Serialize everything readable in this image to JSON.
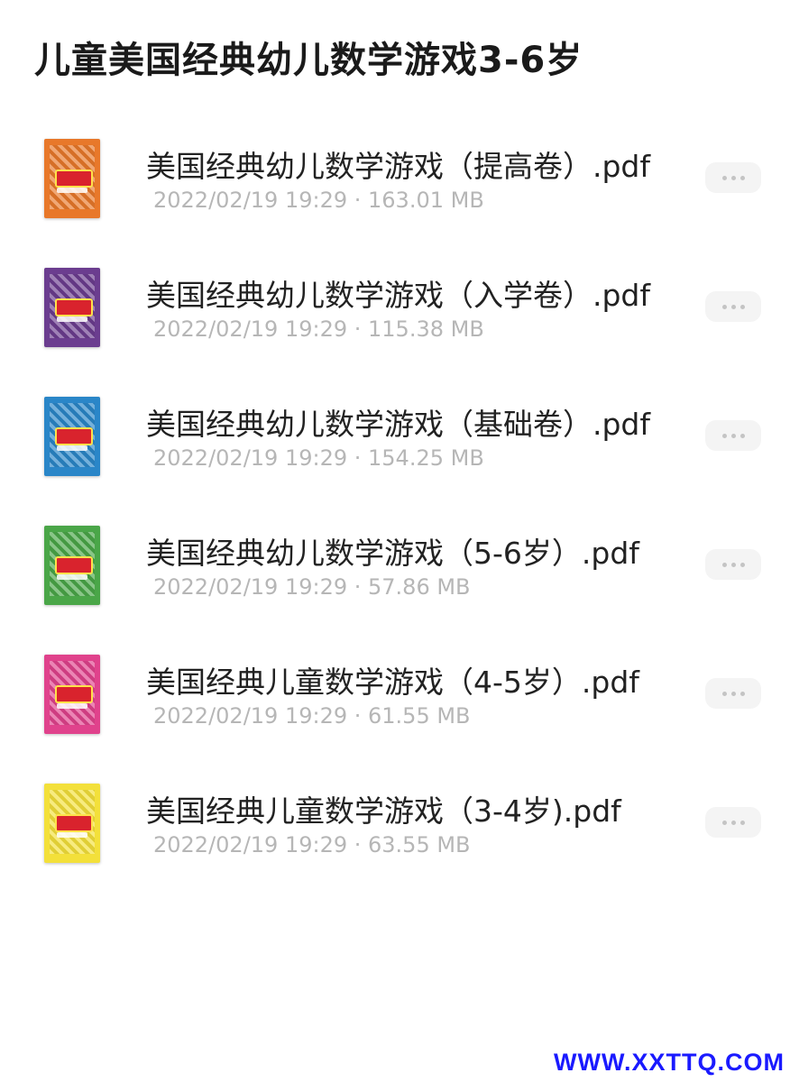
{
  "folder": {
    "title": "儿童美国经典幼儿数学游戏3-6岁"
  },
  "files": [
    {
      "name": "美国经典幼儿数学游戏（提高卷）.pdf",
      "meta": "2022/02/19 19:29 · 163.01 MB",
      "cover_color": "#e8782a"
    },
    {
      "name": "美国经典幼儿数学游戏（入学卷）.pdf",
      "meta": "2022/02/19 19:29 · 115.38 MB",
      "cover_color": "#6b3d8f"
    },
    {
      "name": "美国经典幼儿数学游戏（基础卷）.pdf",
      "meta": "2022/02/19 19:29 · 154.25 MB",
      "cover_color": "#2a86c8"
    },
    {
      "name": "美国经典幼儿数学游戏（5-6岁）.pdf",
      "meta": "2022/02/19 19:29 · 57.86 MB",
      "cover_color": "#4aa648"
    },
    {
      "name": "美国经典儿童数学游戏（4-5岁）.pdf",
      "meta": "2022/02/19 19:29 · 61.55 MB",
      "cover_color": "#e0428c"
    },
    {
      "name": "美国经典儿童数学游戏（3-4岁).pdf",
      "meta": "2022/02/19 19:29 · 63.55 MB",
      "cover_color": "#f3e03a"
    }
  ],
  "more_icon": "more-horizontal-icon",
  "watermark": "WWW.XXTTQ.COM"
}
